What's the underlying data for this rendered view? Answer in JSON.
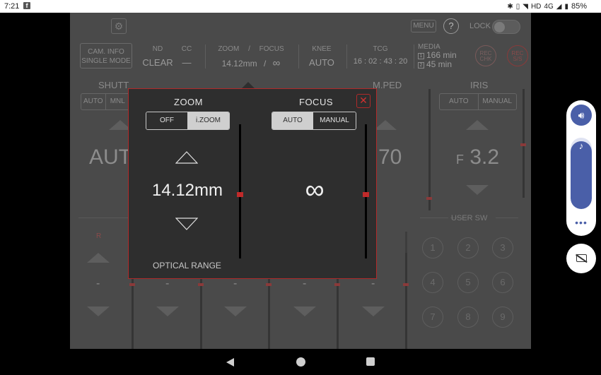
{
  "status_bar": {
    "time": "7:21",
    "app_icon": "facebook-icon",
    "network": "4G",
    "hd": "HD",
    "battery": "85%"
  },
  "top_bar": {
    "settings_icon": "gear-icon",
    "menu_label": "MENU",
    "help_label": "?",
    "lock_label": "LOCK",
    "lock_on": false
  },
  "info_bar": {
    "cam_info_line1": "CAM. INFO",
    "cam_info_line2": "SINGLE MODE",
    "nd_label": "ND",
    "nd_value": "CLEAR",
    "cc_label": "CC",
    "cc_value": "—",
    "zoom_label": "ZOOM",
    "zoom_sep": "/",
    "focus_label": "FOCUS",
    "zoom_value": "14.12mm",
    "zoom_value_sep": "/",
    "focus_value": "∞",
    "knee_label": "KNEE",
    "knee_value": "AUTO",
    "tcg_label": "TCG",
    "tcg_value": "16 : 02 : 43 : 20",
    "media_label": "MEDIA",
    "media_1_slot": "1",
    "media_1_value": "166 min",
    "media_2_slot": "2",
    "media_2_value": "45 min",
    "rec_chk_line1": "REC",
    "rec_chk_line2": "CHK",
    "rec_ss_line1": "REC",
    "rec_ss_line2": "S/S"
  },
  "background": {
    "shutter_title": "SHUTT",
    "shutter_auto": "AUTO",
    "shutter_mnl": "MNL",
    "shutter_value": "AUT",
    "mped_title": "M.PED",
    "mped_value": "70",
    "iris_title": "IRIS",
    "iris_auto": "AUTO",
    "iris_manual": "MANUAL",
    "iris_prefix": "F",
    "iris_value": "3.2",
    "user_sw_label": "USER SW",
    "r_label": "R",
    "dash": "-",
    "user_buttons": [
      "1",
      "2",
      "3",
      "4",
      "5",
      "6",
      "7",
      "8",
      "9"
    ]
  },
  "popup": {
    "zoom_title": "ZOOM",
    "zoom_off": "OFF",
    "zoom_izoom": "i.ZOOM",
    "zoom_selected": "i.ZOOM",
    "zoom_value": "14.12mm",
    "optical_range": "OPTICAL RANGE",
    "focus_title": "FOCUS",
    "focus_auto": "AUTO",
    "focus_manual": "MANUAL",
    "focus_selected": "AUTO",
    "focus_value": "∞",
    "close_label": "✕",
    "zoom_slider_level": 0.48,
    "focus_slider_level": 0.48
  },
  "volume_panel": {
    "speaker_icon": "speaker-icon",
    "music_note_icon": "music-note-icon",
    "level": 0.95,
    "more_label": "•••",
    "caption_icon": "captions-off-icon"
  },
  "nav_bar": {
    "back_icon": "back-icon",
    "home_icon": "home-icon",
    "recents_icon": "recents-icon"
  },
  "colors": {
    "accent_red": "#b02a2a",
    "volume_blue": "#4a5fa8"
  }
}
